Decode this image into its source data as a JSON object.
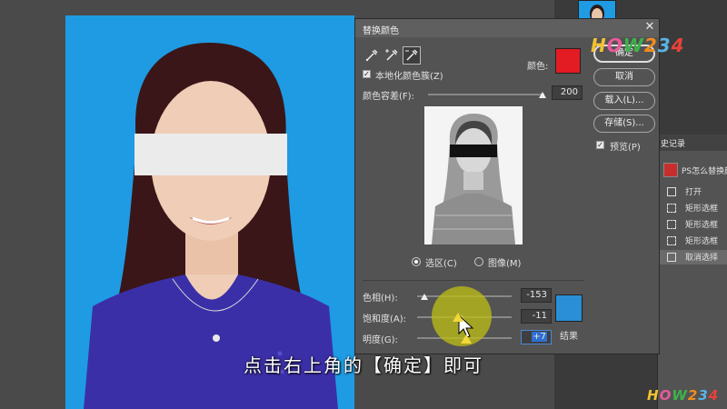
{
  "dialog": {
    "title": "替换颜色",
    "close_glyph": "✕",
    "localized_clusters_label": "本地化颜色簇(Z)",
    "localized_clusters_checked": true,
    "color_label": "颜色:",
    "selected_color": "#e31b23",
    "fuzziness_label": "颜色容差(F):",
    "fuzziness_value": "200",
    "mode_selection_label": "选区(C)",
    "mode_image_label": "图像(M)",
    "hue_label": "色相(H):",
    "hue_value": "-153",
    "hue_level": 0.075,
    "saturation_label": "饱和度(A):",
    "saturation_value": "-11",
    "saturation_level": 0.47,
    "lightness_label": "明度(G):",
    "lightness_value": "+7",
    "lightness_level": 0.53,
    "result_color": "#2a8fd6",
    "result_label": "结果",
    "buttons": {
      "ok": "确定",
      "cancel": "取消",
      "load": "载入(L)...",
      "save": "存储(S)..."
    },
    "preview_label": "预览(P)",
    "preview_checked": true
  },
  "history": {
    "header": "史记录",
    "snapshot_label": "PS怎么替换颜",
    "items": [
      "打开",
      "矩形选框",
      "矩形选框",
      "矩形选框",
      "取消选择"
    ]
  },
  "canvas": {
    "background_color": "#1e9be3"
  },
  "subtitle": "点击右上角的【确定】即可",
  "watermark": "HOW234",
  "icons": [
    "eyedropper-icon",
    "eyedropper-plus-icon",
    "eyedropper-minus-icon",
    "close-icon",
    "cursor-icon"
  ]
}
